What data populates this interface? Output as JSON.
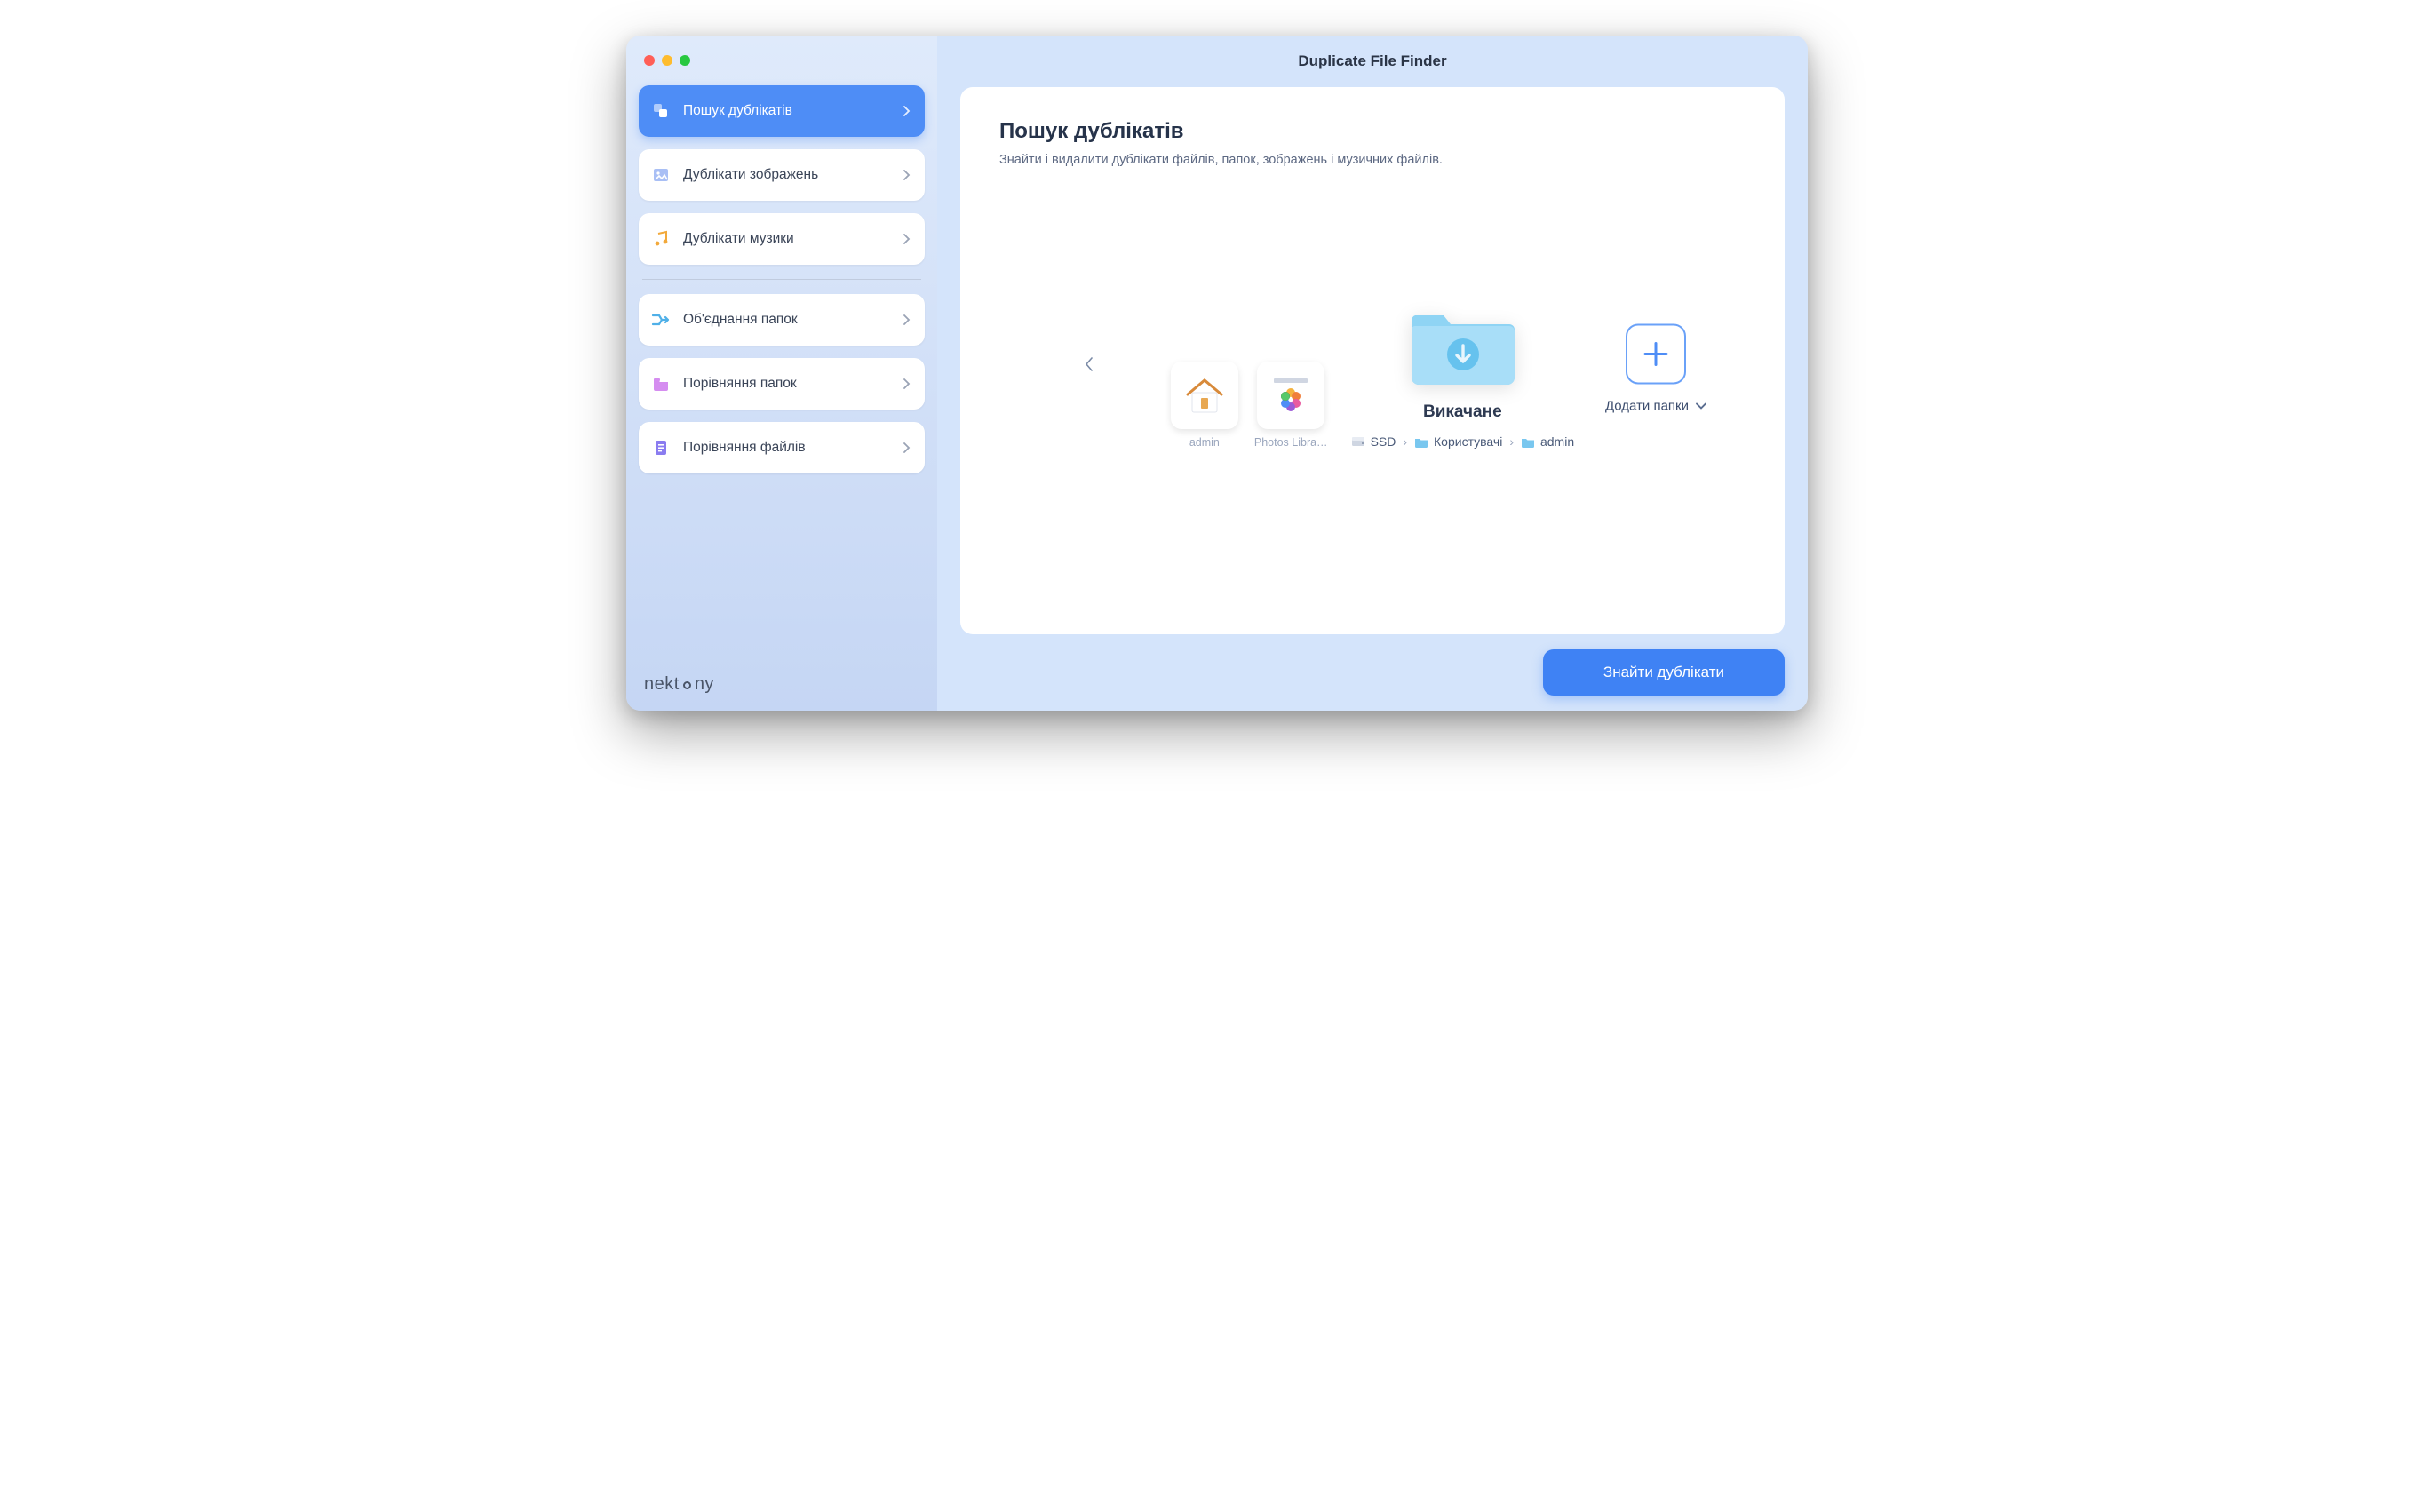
{
  "app_title": "Duplicate File Finder",
  "brand": "nektony",
  "sidebar": {
    "items": [
      {
        "label": "Пошук дублікатів",
        "icon": "duplicates-icon",
        "active": true
      },
      {
        "label": "Дублікати зображень",
        "icon": "image-icon",
        "active": false
      },
      {
        "label": "Дублікати музики",
        "icon": "music-icon",
        "active": false
      },
      {
        "label": "Об'єднання папок",
        "icon": "merge-icon",
        "active": false
      },
      {
        "label": "Порівняння папок",
        "icon": "folder-compare-icon",
        "active": false
      },
      {
        "label": "Порівняння файлів",
        "icon": "file-compare-icon",
        "active": false
      }
    ]
  },
  "page": {
    "title": "Пошук дублікатів",
    "subtitle": "Знайти і видалити дублікати файлів, папок, зображень і музичних файлів."
  },
  "targets": {
    "small": [
      {
        "label": "admin",
        "kind": "home"
      },
      {
        "label": "Photos Libra…",
        "kind": "photos"
      }
    ],
    "selected": {
      "name": "Викачане",
      "breadcrumb": [
        {
          "label": "SSD",
          "icon": "disk-icon"
        },
        {
          "label": "Користувачі",
          "icon": "folder-mini-icon"
        },
        {
          "label": "admin",
          "icon": "folder-mini-icon"
        }
      ]
    }
  },
  "add": {
    "button_label": "Додати папки"
  },
  "action": {
    "primary": "Знайти дублікати"
  }
}
